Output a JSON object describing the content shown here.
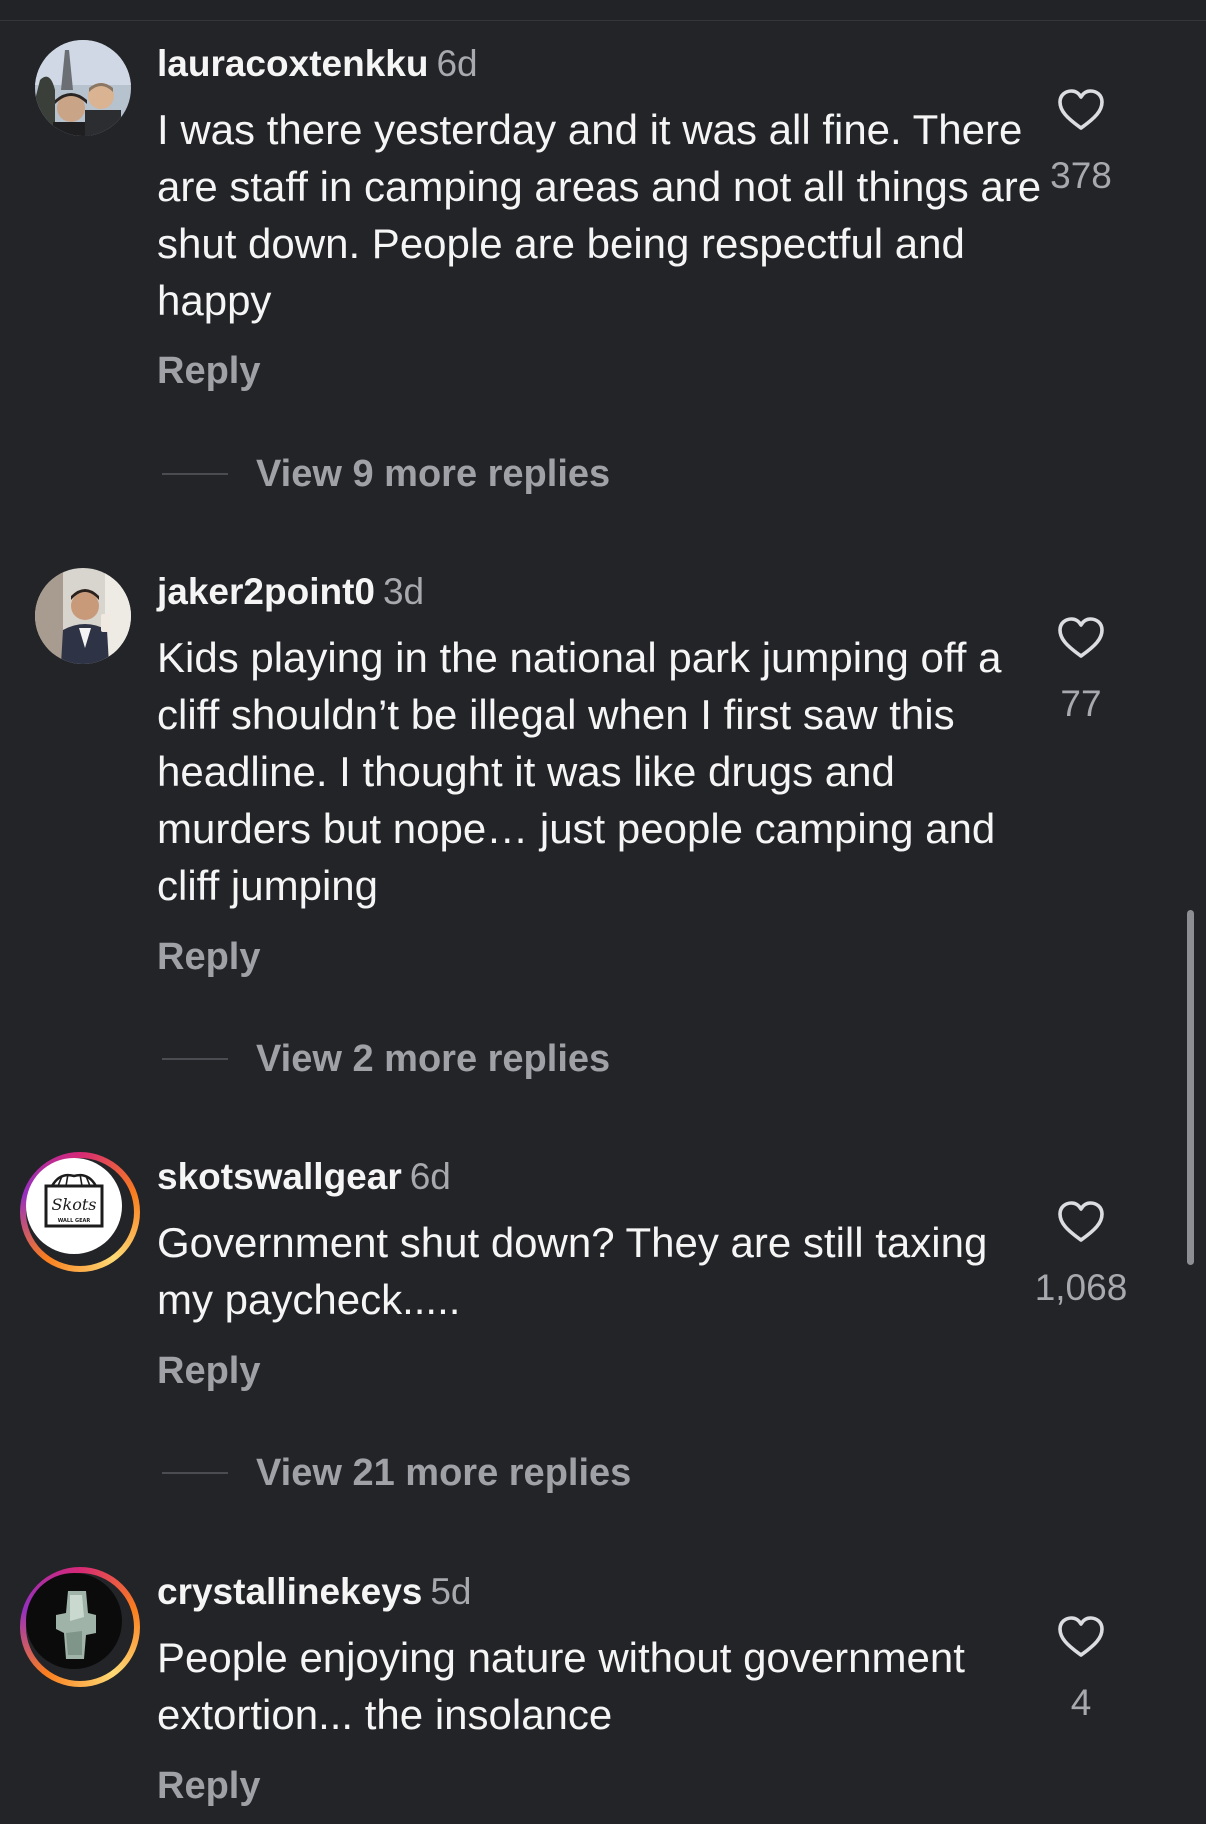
{
  "comments": [
    {
      "username": "lauracoxtenkku",
      "age": "6d",
      "text": "I was there yesterday and it was all fine. There are staff in camping areas and not all things are shut down. People are being respectful and happy",
      "reply_label": "Reply",
      "view_more": "View 9 more replies",
      "likes": "378",
      "avatar": "photo of two people in front of the Eiffel Tower"
    },
    {
      "username": "jaker2point0",
      "age": "3d",
      "text": "Kids playing in the national park jumping off a cliff shouldn’t be illegal when I first saw this headline. I thought it was like drugs and murders but nope… just people camping and cliff jumping",
      "reply_label": "Reply",
      "view_more": "View 2 more replies",
      "likes": "77",
      "avatar": "mirror selfie of man in suit vest"
    },
    {
      "username": "skotswallgear",
      "age": "6d",
      "text": "Government shut down?  They are still taxing my paycheck.....",
      "reply_label": "Reply",
      "view_more": "View 21 more replies",
      "likes": "1,068",
      "avatar": "logo",
      "logo_text": "Skots",
      "logo_sub": "WALL GEAR"
    },
    {
      "username": "crystallinekeys",
      "age": "5d",
      "text": "People enjoying nature without government extortion... the insolance",
      "reply_label": "Reply",
      "likes": "4",
      "avatar": "crystal photo"
    }
  ],
  "icons": {
    "like": "heart-outline-icon"
  },
  "colors": {
    "background": "#232428",
    "text": "#f5f5f5",
    "muted": "#9fa1a6"
  }
}
